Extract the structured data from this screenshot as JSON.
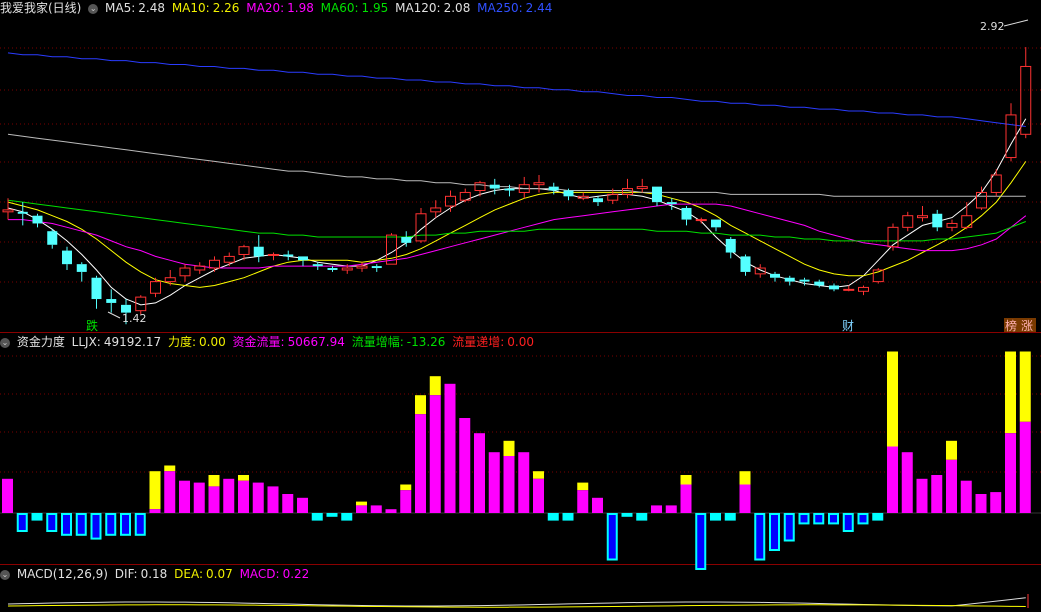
{
  "main_header": {
    "stock": "我爱我家(日线)",
    "ma5_label": "MA5:",
    "ma5": "2.48",
    "ma10_label": "MA10:",
    "ma10": "2.26",
    "ma20_label": "MA20:",
    "ma20": "1.98",
    "ma60_label": "MA60:",
    "ma60": "1.95",
    "ma120_label": "MA120:",
    "ma120": "2.08",
    "ma250_label": "MA250:",
    "ma250": "2.44"
  },
  "flow_header": {
    "title": "资金力度",
    "lljx_label": "LLJX:",
    "lljx": "49192.17",
    "lidu_label": "力度:",
    "lidu": "0.00",
    "flow_label": "资金流量:",
    "flow": "50667.94",
    "inc_label": "流量增幅:",
    "inc": "-13.26",
    "inc2_label": "流量递增:",
    "inc2": "0.00"
  },
  "macd_header": {
    "title": "MACD(12,26,9)",
    "dif_label": "DIF:",
    "dif": "0.18",
    "dea_label": "DEA:",
    "dea": "0.07",
    "macd_label": "MACD:",
    "macd": "0.22"
  },
  "annotations": {
    "high": "2.92",
    "low": "1.42",
    "tag_die": "跌",
    "tag_cai": "财",
    "tag_bang": "榜",
    "tag_zhang": "涨"
  },
  "colors": {
    "bg": "#000000",
    "up": "#ff3232",
    "down": "#54ffff",
    "grid": "#7a0000",
    "ma5": "#ffffff",
    "ma10": "#ffff00",
    "ma20": "#ff00ff",
    "ma60": "#00e000",
    "ma120": "#bbbbbb",
    "ma250": "#2a3cff",
    "flow_pos": "#ff00ff",
    "flow_pos2": "#ffff00",
    "flow_neg": "#00ffff",
    "flow_neg2": "#0000ff"
  },
  "chart_data": [
    {
      "type": "candlestick",
      "title": "我爱我家(日线)",
      "ylim": [
        1.38,
        3.0
      ],
      "candles": [
        [
          2.0,
          2.01,
          1.96,
          2.07
        ],
        [
          2.0,
          1.99,
          1.93,
          2.05
        ],
        [
          1.98,
          1.94,
          1.92,
          1.99
        ],
        [
          1.9,
          1.83,
          1.81,
          1.91
        ],
        [
          1.8,
          1.73,
          1.7,
          1.82
        ],
        [
          1.73,
          1.69,
          1.64,
          1.74
        ],
        [
          1.66,
          1.55,
          1.5,
          1.67
        ],
        [
          1.55,
          1.53,
          1.48,
          1.6
        ],
        [
          1.52,
          1.48,
          1.42,
          1.55
        ],
        [
          1.49,
          1.56,
          1.47,
          1.57
        ],
        [
          1.58,
          1.64,
          1.56,
          1.66
        ],
        [
          1.64,
          1.66,
          1.62,
          1.7
        ],
        [
          1.67,
          1.71,
          1.64,
          1.73
        ],
        [
          1.7,
          1.72,
          1.68,
          1.74
        ],
        [
          1.71,
          1.75,
          1.69,
          1.77
        ],
        [
          1.74,
          1.77,
          1.72,
          1.79
        ],
        [
          1.78,
          1.82,
          1.75,
          1.83
        ],
        [
          1.82,
          1.77,
          1.74,
          1.88
        ],
        [
          1.78,
          1.78,
          1.75,
          1.79
        ],
        [
          1.78,
          1.77,
          1.75,
          1.8
        ],
        [
          1.77,
          1.75,
          1.72,
          1.77
        ],
        [
          1.73,
          1.72,
          1.7,
          1.74
        ],
        [
          1.71,
          1.7,
          1.69,
          1.72
        ],
        [
          1.7,
          1.71,
          1.68,
          1.73
        ],
        [
          1.71,
          1.72,
          1.69,
          1.74
        ],
        [
          1.72,
          1.71,
          1.69,
          1.73
        ],
        [
          1.73,
          1.88,
          1.73,
          1.89
        ],
        [
          1.87,
          1.84,
          1.82,
          1.9
        ],
        [
          1.85,
          1.99,
          1.84,
          2.02
        ],
        [
          2.0,
          2.02,
          1.97,
          2.06
        ],
        [
          2.03,
          2.08,
          2.0,
          2.11
        ],
        [
          2.06,
          2.1,
          2.05,
          2.12
        ],
        [
          2.11,
          2.15,
          2.08,
          2.16
        ],
        [
          2.14,
          2.12,
          2.09,
          2.17
        ],
        [
          2.12,
          2.11,
          2.08,
          2.14
        ],
        [
          2.1,
          2.14,
          2.07,
          2.18
        ],
        [
          2.14,
          2.15,
          2.1,
          2.19
        ],
        [
          2.13,
          2.11,
          2.09,
          2.15
        ],
        [
          2.11,
          2.08,
          2.06,
          2.12
        ],
        [
          2.07,
          2.08,
          2.06,
          2.1
        ],
        [
          2.07,
          2.05,
          2.03,
          2.08
        ],
        [
          2.06,
          2.09,
          2.04,
          2.12
        ],
        [
          2.09,
          2.12,
          2.07,
          2.17
        ],
        [
          2.12,
          2.13,
          2.1,
          2.17
        ],
        [
          2.13,
          2.05,
          2.03,
          2.13
        ],
        [
          2.05,
          2.04,
          2.01,
          2.07
        ],
        [
          2.02,
          1.96,
          1.93,
          2.03
        ],
        [
          1.96,
          1.96,
          1.94,
          1.97
        ],
        [
          1.96,
          1.92,
          1.9,
          1.96
        ],
        [
          1.86,
          1.79,
          1.76,
          1.87
        ],
        [
          1.77,
          1.69,
          1.67,
          1.78
        ],
        [
          1.68,
          1.71,
          1.66,
          1.73
        ],
        [
          1.68,
          1.66,
          1.64,
          1.69
        ],
        [
          1.66,
          1.64,
          1.62,
          1.67
        ],
        [
          1.65,
          1.64,
          1.62,
          1.66
        ],
        [
          1.64,
          1.62,
          1.61,
          1.65
        ],
        [
          1.62,
          1.6,
          1.59,
          1.63
        ],
        [
          1.6,
          1.6,
          1.59,
          1.62
        ],
        [
          1.59,
          1.61,
          1.57,
          1.62
        ],
        [
          1.64,
          1.7,
          1.63,
          1.71
        ],
        [
          1.82,
          1.92,
          1.8,
          1.94
        ],
        [
          1.92,
          1.98,
          1.9,
          2.0
        ],
        [
          1.97,
          1.98,
          1.95,
          2.03
        ],
        [
          1.99,
          1.92,
          1.9,
          2.01
        ],
        [
          1.92,
          1.94,
          1.9,
          1.96
        ],
        [
          1.92,
          1.98,
          1.91,
          2.05
        ],
        [
          2.02,
          2.1,
          2.01,
          2.13
        ],
        [
          2.1,
          2.19,
          2.08,
          2.22
        ],
        [
          2.28,
          2.5,
          2.26,
          2.56
        ],
        [
          2.4,
          2.75,
          2.38,
          2.85
        ]
      ],
      "series": [
        {
          "name": "MA5",
          "values": [
            2.02,
            2.0,
            1.96,
            1.91,
            1.85,
            1.78,
            1.7,
            1.61,
            1.55,
            1.52,
            1.53,
            1.57,
            1.62,
            1.66,
            1.7,
            1.73,
            1.76,
            1.77,
            1.78,
            1.77,
            1.76,
            1.74,
            1.73,
            1.72,
            1.72,
            1.75,
            1.79,
            1.84,
            1.91,
            1.97,
            2.02,
            2.06,
            2.09,
            2.11,
            2.12,
            2.12,
            2.12,
            2.11,
            2.09,
            2.07,
            2.08,
            2.09,
            2.09,
            2.08,
            2.06,
            2.03,
            2.0,
            1.95,
            1.87,
            1.8,
            1.74,
            1.7,
            1.67,
            1.65,
            1.63,
            1.62,
            1.61,
            1.62,
            1.67,
            1.75,
            1.83,
            1.88,
            1.93,
            1.95,
            1.97,
            2.03,
            2.1,
            2.21,
            2.35,
            2.48
          ]
        },
        {
          "name": "MA10",
          "values": [
            2.05,
            2.03,
            2.01,
            1.98,
            1.95,
            1.91,
            1.86,
            1.8,
            1.74,
            1.69,
            1.65,
            1.63,
            1.62,
            1.61,
            1.62,
            1.64,
            1.66,
            1.69,
            1.72,
            1.74,
            1.75,
            1.75,
            1.75,
            1.75,
            1.74,
            1.75,
            1.76,
            1.78,
            1.81,
            1.85,
            1.89,
            1.93,
            1.97,
            2.01,
            2.04,
            2.07,
            2.09,
            2.1,
            2.1,
            2.1,
            2.1,
            2.1,
            2.1,
            2.1,
            2.09,
            2.07,
            2.05,
            2.02,
            1.98,
            1.93,
            1.89,
            1.85,
            1.81,
            1.77,
            1.73,
            1.7,
            1.68,
            1.67,
            1.67,
            1.69,
            1.72,
            1.75,
            1.79,
            1.83,
            1.87,
            1.92,
            1.98,
            2.05,
            2.15,
            2.26
          ]
        },
        {
          "name": "MA20",
          "values": [
            1.96,
            1.96,
            1.95,
            1.94,
            1.92,
            1.9,
            1.88,
            1.85,
            1.82,
            1.8,
            1.77,
            1.75,
            1.73,
            1.72,
            1.71,
            1.71,
            1.71,
            1.71,
            1.72,
            1.72,
            1.72,
            1.72,
            1.72,
            1.72,
            1.73,
            1.74,
            1.75,
            1.76,
            1.78,
            1.8,
            1.82,
            1.84,
            1.86,
            1.88,
            1.9,
            1.92,
            1.94,
            1.96,
            1.97,
            1.98,
            1.99,
            2.0,
            2.01,
            2.02,
            2.03,
            2.04,
            2.04,
            2.04,
            2.04,
            2.03,
            2.01,
            1.99,
            1.97,
            1.95,
            1.93,
            1.9,
            1.88,
            1.86,
            1.84,
            1.83,
            1.82,
            1.81,
            1.8,
            1.8,
            1.8,
            1.81,
            1.83,
            1.86,
            1.92,
            1.98
          ]
        },
        {
          "name": "MA60",
          "values": [
            2.06,
            2.05,
            2.04,
            2.03,
            2.02,
            2.01,
            2.0,
            1.99,
            1.98,
            1.97,
            1.96,
            1.95,
            1.94,
            1.93,
            1.92,
            1.91,
            1.9,
            1.89,
            1.89,
            1.88,
            1.88,
            1.87,
            1.87,
            1.87,
            1.87,
            1.87,
            1.87,
            1.87,
            1.88,
            1.88,
            1.89,
            1.89,
            1.9,
            1.9,
            1.9,
            1.9,
            1.91,
            1.91,
            1.91,
            1.91,
            1.91,
            1.91,
            1.91,
            1.91,
            1.9,
            1.9,
            1.9,
            1.89,
            1.89,
            1.88,
            1.88,
            1.88,
            1.87,
            1.87,
            1.86,
            1.86,
            1.85,
            1.85,
            1.85,
            1.85,
            1.85,
            1.85,
            1.85,
            1.86,
            1.86,
            1.87,
            1.88,
            1.89,
            1.92,
            1.95
          ]
        },
        {
          "name": "MA120",
          "values": [
            2.4,
            2.39,
            2.38,
            2.37,
            2.36,
            2.35,
            2.34,
            2.33,
            2.32,
            2.31,
            2.3,
            2.29,
            2.28,
            2.27,
            2.26,
            2.25,
            2.24,
            2.23,
            2.22,
            2.21,
            2.21,
            2.2,
            2.19,
            2.18,
            2.18,
            2.17,
            2.17,
            2.16,
            2.16,
            2.15,
            2.15,
            2.14,
            2.14,
            2.13,
            2.13,
            2.12,
            2.12,
            2.12,
            2.11,
            2.11,
            2.11,
            2.11,
            2.11,
            2.1,
            2.1,
            2.1,
            2.1,
            2.1,
            2.1,
            2.09,
            2.09,
            2.09,
            2.09,
            2.09,
            2.09,
            2.09,
            2.08,
            2.08,
            2.08,
            2.08,
            2.08,
            2.08,
            2.08,
            2.08,
            2.08,
            2.08,
            2.08,
            2.08,
            2.08,
            2.08
          ]
        },
        {
          "name": "MA250",
          "values": [
            2.82,
            2.81,
            2.81,
            2.8,
            2.8,
            2.79,
            2.79,
            2.78,
            2.78,
            2.77,
            2.77,
            2.76,
            2.76,
            2.75,
            2.75,
            2.74,
            2.74,
            2.73,
            2.73,
            2.72,
            2.72,
            2.71,
            2.71,
            2.7,
            2.7,
            2.69,
            2.69,
            2.68,
            2.68,
            2.67,
            2.67,
            2.66,
            2.66,
            2.65,
            2.65,
            2.64,
            2.64,
            2.63,
            2.63,
            2.62,
            2.62,
            2.61,
            2.6,
            2.6,
            2.59,
            2.59,
            2.58,
            2.57,
            2.57,
            2.56,
            2.56,
            2.55,
            2.55,
            2.54,
            2.54,
            2.53,
            2.53,
            2.52,
            2.52,
            2.51,
            2.51,
            2.5,
            2.5,
            2.49,
            2.49,
            2.48,
            2.47,
            2.46,
            2.45,
            2.44
          ]
        }
      ]
    },
    {
      "type": "bar",
      "title": "资金力度",
      "ylim": [
        -1,
        1
      ],
      "values": [
        0.18,
        -0.1,
        -0.04,
        -0.1,
        -0.12,
        -0.12,
        -0.14,
        -0.12,
        -0.12,
        -0.12,
        0.02,
        0.22,
        0.17,
        0.16,
        0.14,
        0.18,
        0.17,
        0.16,
        0.14,
        0.1,
        0.08,
        -0.04,
        -0.02,
        -0.04,
        0.04,
        0.04,
        0.02,
        0.12,
        0.52,
        0.62,
        0.68,
        0.5,
        0.42,
        0.32,
        0.3,
        0.32,
        0.18,
        -0.04,
        -0.04,
        0.12,
        0.08,
        -0.25,
        -0.02,
        -0.04,
        0.04,
        0.04,
        0.15,
        -0.3,
        -0.04,
        -0.04,
        0.15,
        -0.25,
        -0.2,
        -0.15,
        -0.06,
        -0.06,
        -0.06,
        -0.1,
        -0.06,
        -0.04,
        0.35,
        0.32,
        0.18,
        0.2,
        0.28,
        0.17,
        0.1,
        0.11,
        0.42,
        0.48
      ],
      "yellow_tops": [
        0.18,
        0.0,
        0.0,
        0.0,
        0.0,
        0.0,
        0.0,
        0.0,
        0.0,
        0.0,
        0.22,
        0.25,
        0.17,
        0.16,
        0.2,
        0.18,
        0.2,
        0.16,
        0.14,
        0.1,
        0.08,
        0.0,
        0.0,
        0.0,
        0.06,
        0.04,
        0.02,
        0.15,
        0.62,
        0.72,
        0.68,
        0.5,
        0.42,
        0.32,
        0.38,
        0.32,
        0.22,
        0.0,
        0.0,
        0.16,
        0.08,
        0.0,
        0.0,
        0.0,
        0.04,
        0.04,
        0.2,
        0.0,
        0.0,
        0.0,
        0.22,
        0.0,
        0.0,
        0.0,
        0.0,
        0.0,
        0.0,
        0.0,
        0.0,
        0.0,
        0.85,
        0.32,
        0.18,
        0.2,
        0.38,
        0.17,
        0.1,
        0.11,
        0.85,
        0.85
      ]
    },
    {
      "type": "line",
      "title": "MACD(12,26,9)"
    }
  ]
}
